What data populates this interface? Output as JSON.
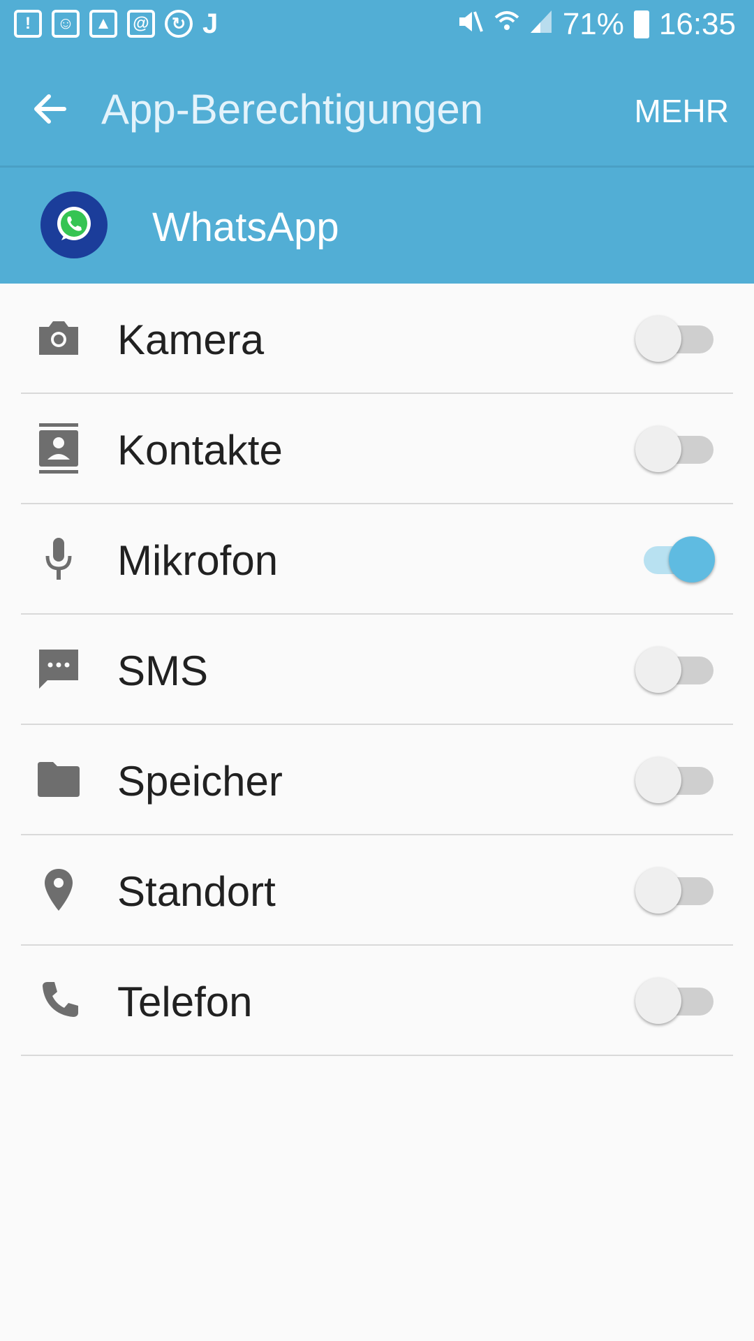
{
  "status_bar": {
    "notification_icons": [
      "alert-icon",
      "message-icon",
      "gallery-icon",
      "email-icon",
      "sync-icon",
      "app-j-icon"
    ],
    "battery_percent": "71%",
    "time": "16:35"
  },
  "app_bar": {
    "title": "App-Berechtigungen",
    "more_label": "MEHR"
  },
  "app_header": {
    "app_name": "WhatsApp"
  },
  "permissions": [
    {
      "label": "Kamera",
      "icon": "camera-icon",
      "enabled": false
    },
    {
      "label": "Kontakte",
      "icon": "contacts-icon",
      "enabled": false
    },
    {
      "label": "Mikrofon",
      "icon": "microphone-icon",
      "enabled": true
    },
    {
      "label": "SMS",
      "icon": "sms-icon",
      "enabled": false
    },
    {
      "label": "Speicher",
      "icon": "folder-icon",
      "enabled": false
    },
    {
      "label": "Standort",
      "icon": "location-icon",
      "enabled": false
    },
    {
      "label": "Telefon",
      "icon": "phone-icon",
      "enabled": false
    }
  ],
  "colors": {
    "accent": "#52aed5",
    "toggle_on": "#5fbbe1",
    "toggle_off": "#cfcfcf"
  }
}
